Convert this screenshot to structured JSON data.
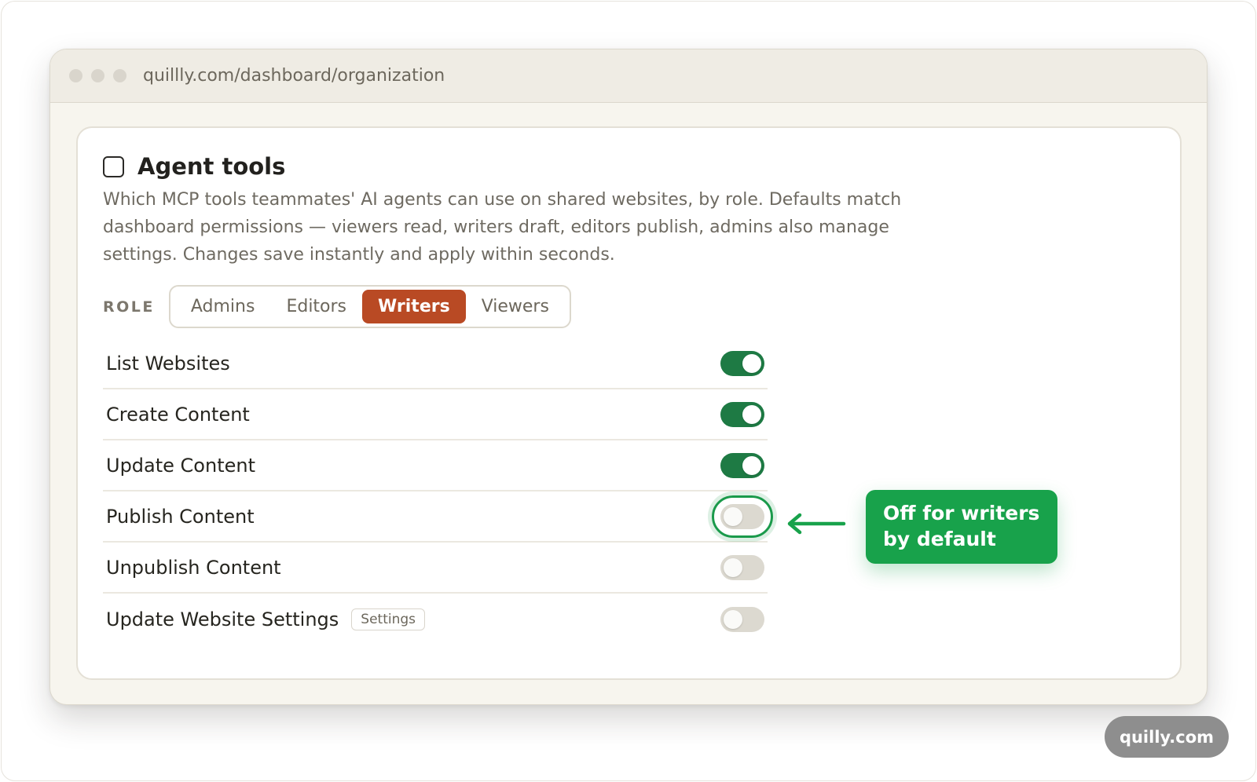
{
  "browser": {
    "url": "quillly.com/dashboard/organization"
  },
  "card": {
    "title": "Agent tools",
    "description": "Which MCP tools teammates' AI agents can use on shared websites, by role. Defaults match dashboard permissions — viewers read, writers draft, editors publish, admins also manage settings. Changes save instantly and apply within seconds."
  },
  "roles": {
    "label": "ROLE",
    "options": [
      "Admins",
      "Editors",
      "Writers",
      "Viewers"
    ],
    "selected": "Writers"
  },
  "tools": [
    {
      "label": "List Websites",
      "enabled": true
    },
    {
      "label": "Create Content",
      "enabled": true
    },
    {
      "label": "Update Content",
      "enabled": true
    },
    {
      "label": "Publish Content",
      "enabled": false,
      "highlighted": true
    },
    {
      "label": "Unpublish Content",
      "enabled": false
    },
    {
      "label": "Update Website Settings",
      "enabled": false,
      "tag": "Settings"
    }
  ],
  "callout": {
    "line1": "Off for writers",
    "line2": "by default",
    "color": "#18a24b"
  },
  "colors": {
    "accent_active_tab": "#b94a24",
    "toggle_on": "#1e7a44",
    "toggle_off": "#dcd9d0"
  },
  "watermark": "quilly.com"
}
